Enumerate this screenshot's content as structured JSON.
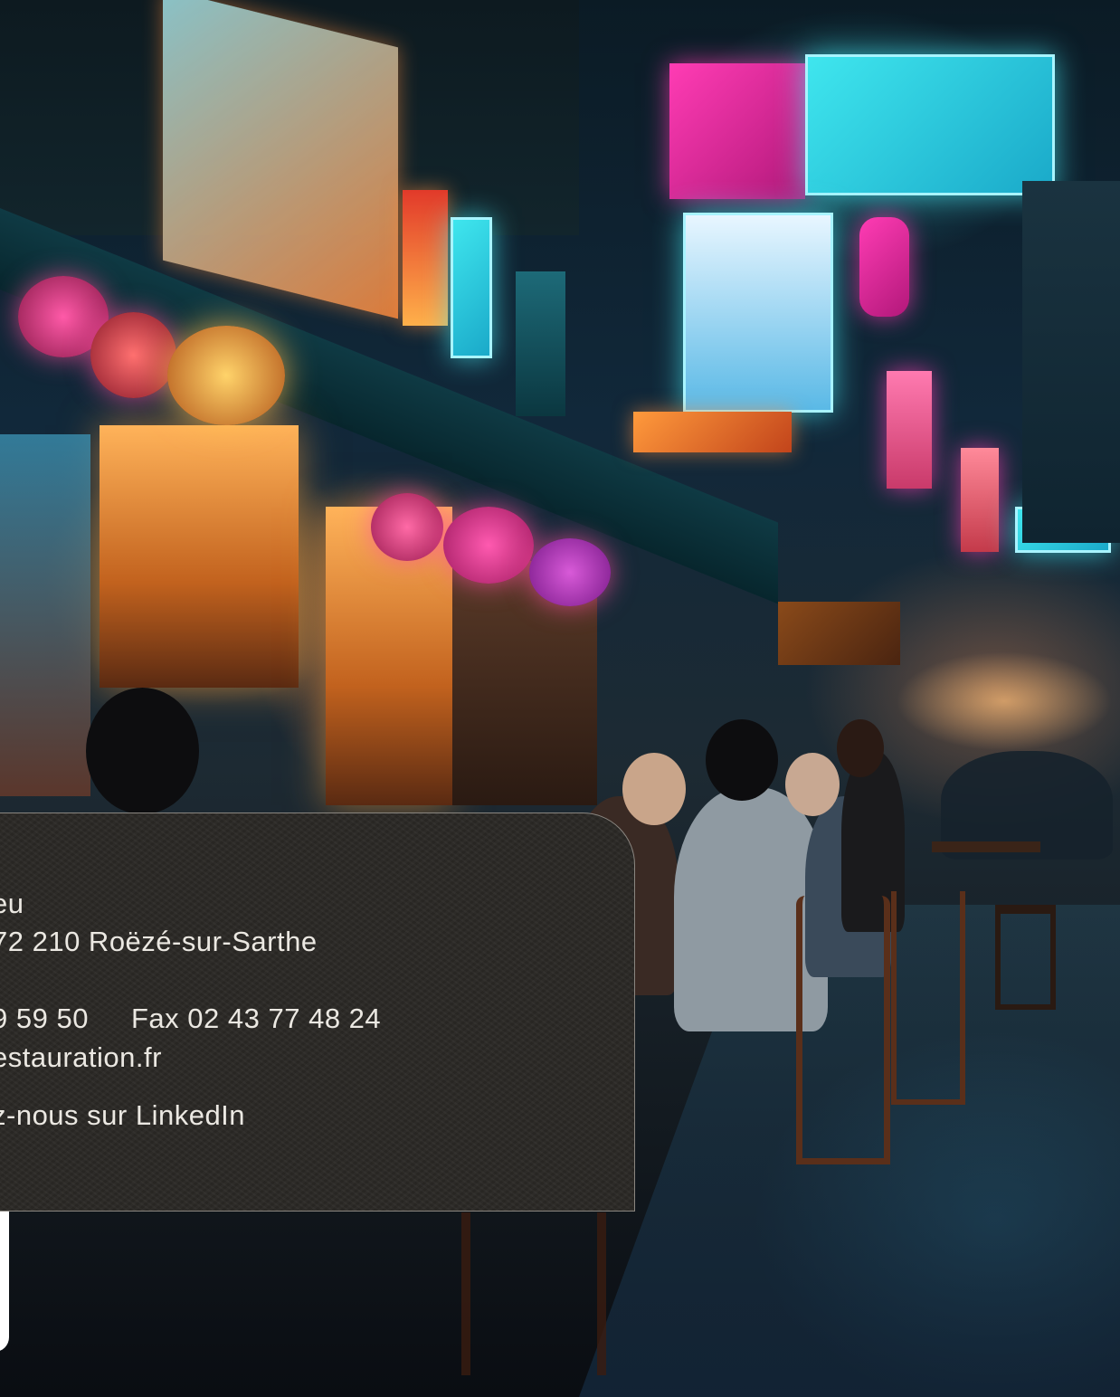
{
  "contact": {
    "address_line1": "eu",
    "address_line2": "72 210 Roëzé-sur-Sarthe",
    "phone": "9 59 50",
    "fax": "Fax 02 43 77 48 24",
    "website": "estauration.fr",
    "linkedin": "z-nous sur LinkedIn"
  },
  "colors": {
    "card_background": "#2a2825",
    "card_text": "#ebe8e2",
    "neon_cyan": "#3fe6ee",
    "neon_pink": "#ff3cb4"
  }
}
